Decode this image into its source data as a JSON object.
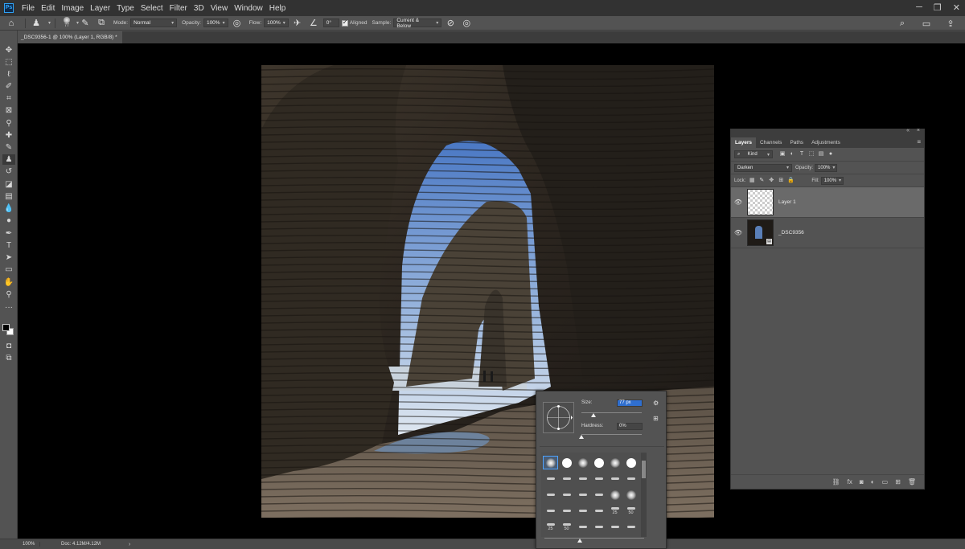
{
  "app": {
    "logo": "Ps"
  },
  "menu": [
    "File",
    "Edit",
    "Image",
    "Layer",
    "Type",
    "Select",
    "Filter",
    "3D",
    "View",
    "Window",
    "Help"
  ],
  "options_bar": {
    "brush_size_badge": "77",
    "mode_label": "Mode:",
    "mode_value": "Normal",
    "opacity_label": "Opacity:",
    "opacity_value": "100%",
    "flow_label": "Flow:",
    "flow_value": "100%",
    "angle_value": "0°",
    "aligned_label": "Aligned",
    "aligned_checked": true,
    "sample_label": "Sample:",
    "sample_value": "Current & Below"
  },
  "document_tab": {
    "title": "_DSC9356-1 @ 100% (Layer 1, RGB/8) *"
  },
  "toolbar": {
    "tools": [
      "move-icon",
      "marquee-icon",
      "lasso-icon",
      "quick-select-icon",
      "crop-icon",
      "frame-icon",
      "eyedropper-icon",
      "healing-brush-icon",
      "brush-icon",
      "clone-stamp-icon",
      "history-brush-icon",
      "eraser-icon",
      "gradient-icon",
      "blur-icon",
      "dodge-icon",
      "pen-icon",
      "type-icon",
      "path-select-icon",
      "rectangle-icon",
      "hand-icon",
      "zoom-icon",
      "more-tools-icon"
    ],
    "active_tool": "clone-stamp-icon",
    "foreground_color": "#000000",
    "background_color": "#ffffff"
  },
  "status_bar": {
    "zoom": "100%",
    "doc_info": "Doc: 4.12M/4.12M"
  },
  "layers_panel": {
    "tabs": [
      "Layers",
      "Channels",
      "Paths",
      "Adjustments"
    ],
    "active_tab": "Layers",
    "filter_kind": "Kind",
    "blend_mode": "Darken",
    "opacity_label": "Opacity:",
    "opacity_value": "100%",
    "lock_label": "Lock:",
    "fill_label": "Fill:",
    "fill_value": "100%",
    "layers": [
      {
        "name": "Layer 1",
        "visible": true,
        "selected": true
      },
      {
        "name": "_DSC9356",
        "visible": true,
        "selected": false
      }
    ]
  },
  "brush_picker": {
    "size_label": "Size:",
    "size_value": "77 px",
    "hardness_label": "Hardness:",
    "hardness_value": "0%",
    "size_slider": 0.2,
    "hardness_slider": 0.0,
    "presets": [
      {
        "kind": "soft",
        "num": ""
      },
      {
        "kind": "hard",
        "num": ""
      },
      {
        "kind": "soft",
        "num": ""
      },
      {
        "kind": "hard",
        "num": ""
      },
      {
        "kind": "soft",
        "num": ""
      },
      {
        "kind": "hard",
        "num": ""
      },
      {
        "kind": "stroke",
        "num": ""
      },
      {
        "kind": "stroke",
        "num": ""
      },
      {
        "kind": "stroke",
        "num": ""
      },
      {
        "kind": "stroke",
        "num": ""
      },
      {
        "kind": "stroke",
        "num": ""
      },
      {
        "kind": "stroke",
        "num": ""
      },
      {
        "kind": "stroke",
        "num": ""
      },
      {
        "kind": "stroke",
        "num": ""
      },
      {
        "kind": "stroke",
        "num": ""
      },
      {
        "kind": "stroke",
        "num": ""
      },
      {
        "kind": "soft",
        "num": ""
      },
      {
        "kind": "soft",
        "num": ""
      },
      {
        "kind": "stroke",
        "num": ""
      },
      {
        "kind": "stroke",
        "num": ""
      },
      {
        "kind": "stroke",
        "num": ""
      },
      {
        "kind": "stroke",
        "num": ""
      },
      {
        "kind": "stroke",
        "num": "25"
      },
      {
        "kind": "stroke",
        "num": "50"
      },
      {
        "kind": "stroke",
        "num": "25"
      },
      {
        "kind": "stroke",
        "num": "50"
      },
      {
        "kind": "stroke",
        "num": ""
      },
      {
        "kind": "stroke",
        "num": ""
      },
      {
        "kind": "stroke",
        "num": ""
      },
      {
        "kind": "stroke",
        "num": ""
      }
    ]
  }
}
